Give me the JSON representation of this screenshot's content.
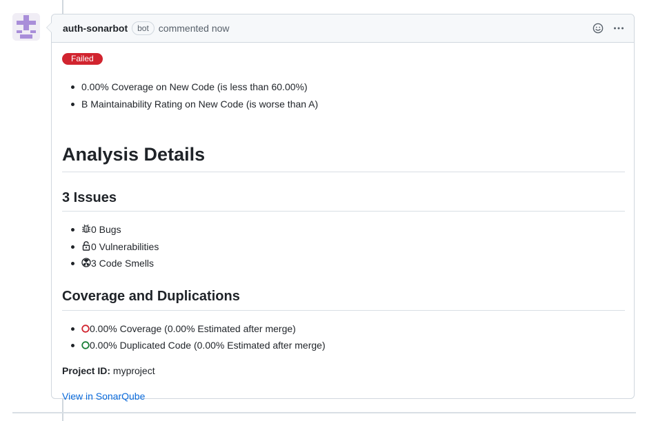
{
  "comment": {
    "author": "auth-sonarbot",
    "badge": "bot",
    "meta": "commented now"
  },
  "report": {
    "status": "Failed",
    "conditions": [
      "0.00% Coverage on New Code (is less than 60.00%)",
      "B Maintainability Rating on New Code (is worse than A)"
    ],
    "heading": "Analysis Details",
    "issues_heading": "3 Issues",
    "issues": [
      {
        "text": "0 Bugs",
        "icon": "bug-icon"
      },
      {
        "text": "0 Vulnerabilities",
        "icon": "lock-open-icon"
      },
      {
        "text": "3 Code Smells",
        "icon": "code-smell-icon"
      }
    ],
    "coverage_heading": "Coverage and Duplications",
    "coverage": [
      {
        "text": "0.00% Coverage (0.00% Estimated after merge)",
        "icon": "circle-red-icon",
        "color": "#d1242f"
      },
      {
        "text": "0.00% Duplicated Code (0.00% Estimated after merge)",
        "icon": "circle-green-icon",
        "color": "#1a7f37"
      }
    ],
    "project_id_label": "Project ID:",
    "project_id": "myproject",
    "link_text": "View in SonarQube"
  },
  "colors": {
    "failed": "#d1242f",
    "link": "#0969da",
    "avatar": "#a98ed9"
  }
}
